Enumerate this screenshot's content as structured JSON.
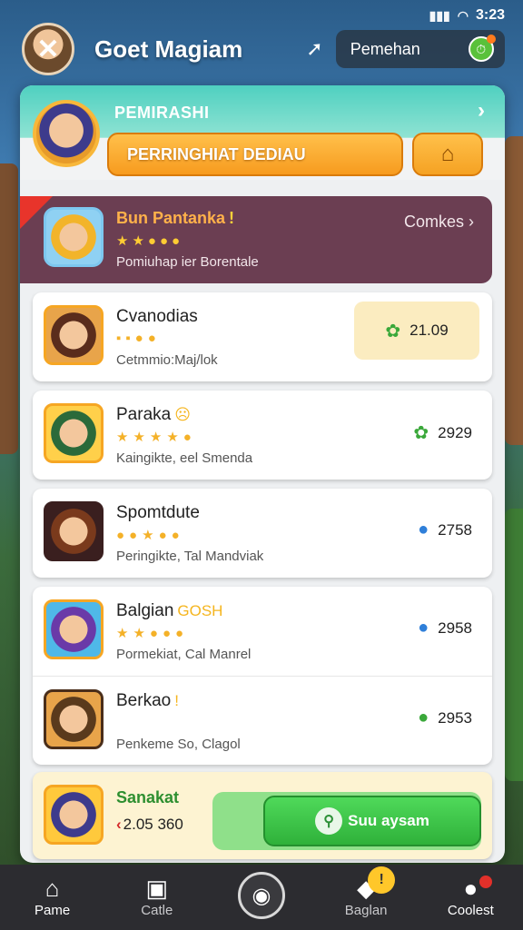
{
  "status": {
    "time": "3:23"
  },
  "header": {
    "title": "Goet Magiam",
    "pill_label": "Pemehan"
  },
  "panel": {
    "title": "PEMIRASHI",
    "orange_button": "PERRINGHIAT DEDIAU"
  },
  "featured": {
    "name": "Bun Pantanka",
    "badge": "!",
    "stars": "★★●●●",
    "description": "Pomiuhap ier Borentale",
    "link": "Comkes"
  },
  "rows": [
    {
      "name": "Cvanodias",
      "badge": "",
      "stars": "▪▪●●",
      "description": "Cetmmio:Maj/lok",
      "score": "21.09",
      "icon": "gear-icon",
      "highlighted": true
    },
    {
      "name": "Paraka",
      "badge": "☹",
      "stars": "★★★★●",
      "description": "Kaingikte, eel Smenda",
      "score": "2929",
      "icon": "gear-icon",
      "highlighted": false
    },
    {
      "name": "Spomtdute",
      "badge": "",
      "stars": "●●★●●",
      "description": "Peringikte, Tal Mandviak",
      "score": "2758",
      "icon": "person-icon",
      "highlighted": false
    },
    {
      "name": "Balgian",
      "badge": "GOSH",
      "stars": "★★●●●",
      "description": "Pormekiat, Cal Manrel",
      "score": "2958",
      "icon": "person-icon",
      "highlighted": false
    },
    {
      "name": "Berkao",
      "badge": "!",
      "stars": "",
      "description": "Penkeme So, Clagol",
      "score": "2953",
      "icon": "chat-icon",
      "highlighted": false
    }
  ],
  "bottom": {
    "name": "Sanakat",
    "value": "2.05 360",
    "button_label": "Suu aysam"
  },
  "nav": [
    {
      "label": "Pame"
    },
    {
      "label": "Catle"
    },
    {
      "label": ""
    },
    {
      "label": "Baglan",
      "notif": "!"
    },
    {
      "label": "Coolest"
    }
  ]
}
